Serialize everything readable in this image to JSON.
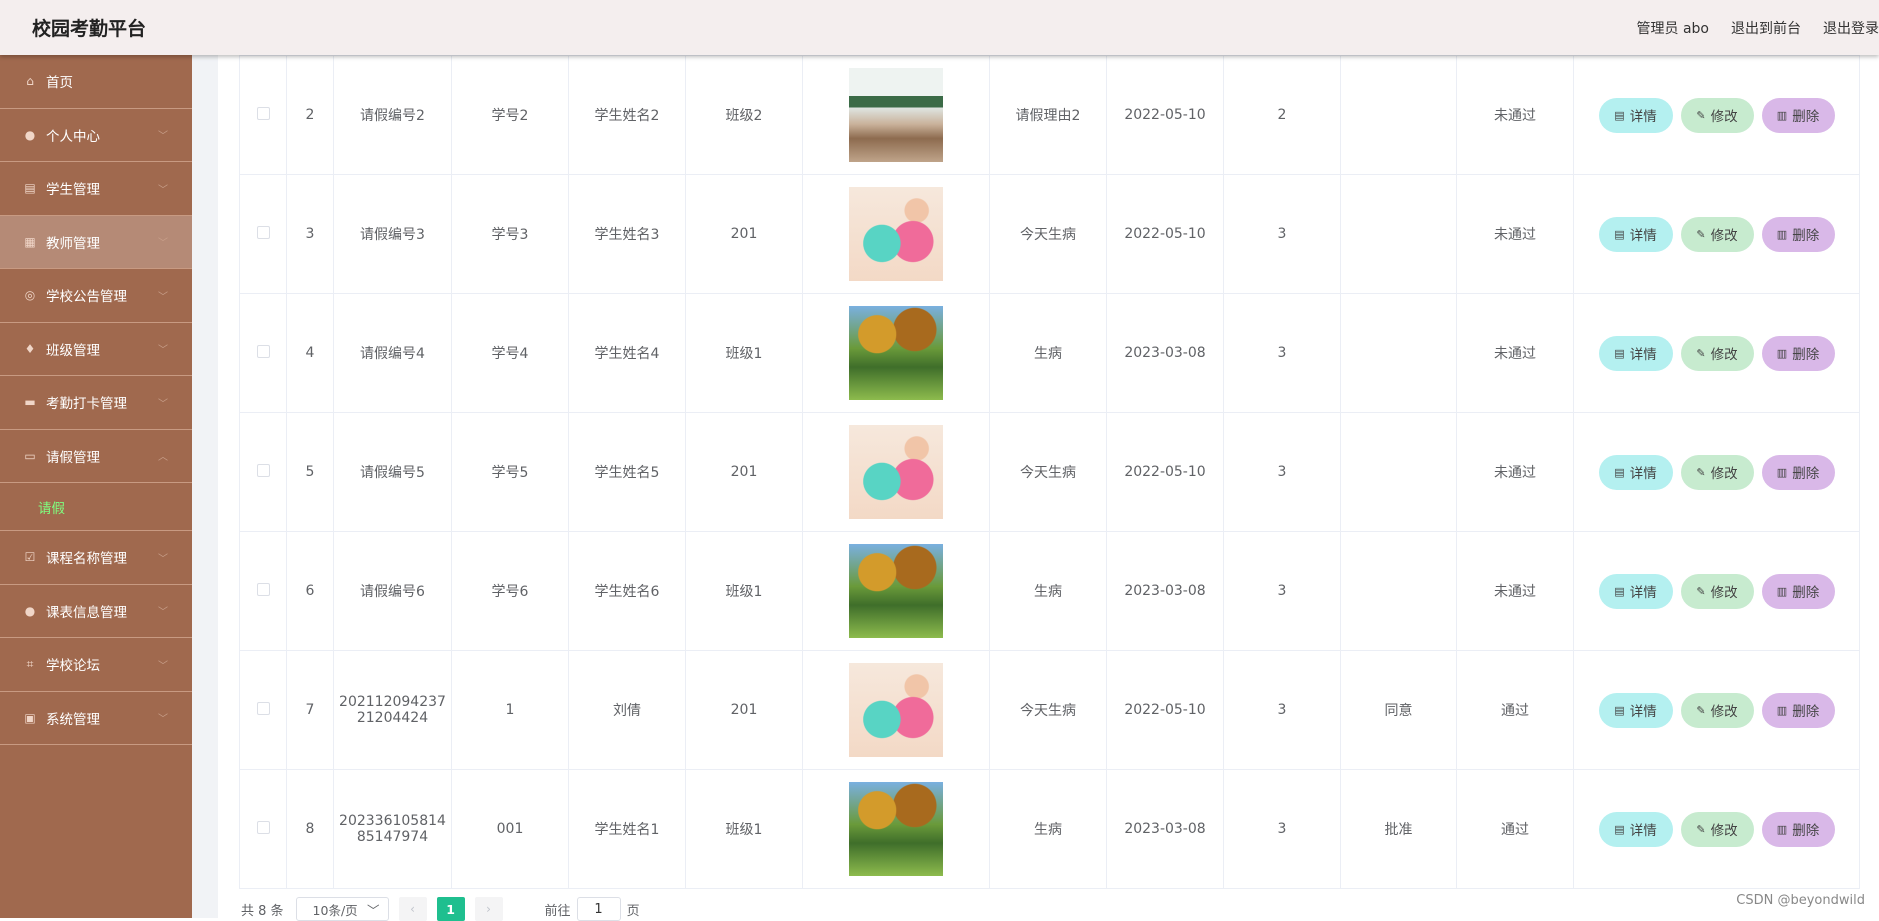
{
  "header": {
    "app_title": "校园考勤平台",
    "admin_label": "管理员 abo",
    "back_front_label": "退出到前台",
    "logout_label": "退出登录"
  },
  "sidebar": {
    "items": [
      {
        "label": "首页",
        "icon": "home-icon",
        "has_arrow": false
      },
      {
        "label": "个人中心",
        "icon": "user-icon",
        "has_arrow": true
      },
      {
        "label": "学生管理",
        "icon": "clipboard-icon",
        "has_arrow": true
      },
      {
        "label": "教师管理",
        "icon": "grid-icon",
        "has_arrow": true,
        "active": true
      },
      {
        "label": "学校公告管理",
        "icon": "compass-icon",
        "has_arrow": true
      },
      {
        "label": "班级管理",
        "icon": "location-icon",
        "has_arrow": true
      },
      {
        "label": "考勤打卡管理",
        "icon": "ticket-icon",
        "has_arrow": true
      },
      {
        "label": "请假管理",
        "icon": "chat-icon",
        "has_arrow": true,
        "expanded": true
      },
      {
        "label": "课程名称管理",
        "icon": "checkbox-icon",
        "has_arrow": true
      },
      {
        "label": "课表信息管理",
        "icon": "user-icon",
        "has_arrow": true
      },
      {
        "label": "学校论坛",
        "icon": "crop-icon",
        "has_arrow": true
      },
      {
        "label": "系统管理",
        "icon": "camera-icon",
        "has_arrow": true
      }
    ],
    "sub_item": "请假"
  },
  "table": {
    "rows": [
      {
        "idx": "2",
        "leave_no": "请假编号2",
        "student_no": "学号2",
        "student_name": "学生姓名2",
        "class_name": "班级2",
        "image": "img-classroom",
        "reason": "请假理由2",
        "date": "2022-05-10",
        "days": "2",
        "reply": "",
        "status": "未通过"
      },
      {
        "idx": "3",
        "leave_no": "请假编号3",
        "student_no": "学号3",
        "student_name": "学生姓名3",
        "class_name": "201",
        "image": "img-plush",
        "reason": "今天生病",
        "date": "2022-05-10",
        "days": "3",
        "reply": "",
        "status": "未通过"
      },
      {
        "idx": "4",
        "leave_no": "请假编号4",
        "student_no": "学号4",
        "student_name": "学生姓名4",
        "class_name": "班级1",
        "image": "img-park",
        "reason": "生病",
        "date": "2023-03-08",
        "days": "3",
        "reply": "",
        "status": "未通过"
      },
      {
        "idx": "5",
        "leave_no": "请假编号5",
        "student_no": "学号5",
        "student_name": "学生姓名5",
        "class_name": "201",
        "image": "img-plush",
        "reason": "今天生病",
        "date": "2022-05-10",
        "days": "3",
        "reply": "",
        "status": "未通过"
      },
      {
        "idx": "6",
        "leave_no": "请假编号6",
        "student_no": "学号6",
        "student_name": "学生姓名6",
        "class_name": "班级1",
        "image": "img-park",
        "reason": "生病",
        "date": "2023-03-08",
        "days": "3",
        "reply": "",
        "status": "未通过"
      },
      {
        "idx": "7",
        "leave_no_line1": "202112094237",
        "leave_no_line2": "21204424",
        "student_no": "1",
        "student_name": "刘倩",
        "class_name": "201",
        "image": "img-plush",
        "reason": "今天生病",
        "date": "2022-05-10",
        "days": "3",
        "reply": "同意",
        "status": "通过"
      },
      {
        "idx": "8",
        "leave_no_line1": "202336105814",
        "leave_no_line2": "85147974",
        "student_no": "001",
        "student_name": "学生姓名1",
        "class_name": "班级1",
        "image": "img-park",
        "reason": "生病",
        "date": "2023-03-08",
        "days": "3",
        "reply": "批准",
        "status": "通过"
      }
    ],
    "actions": {
      "detail": "详情",
      "edit": "修改",
      "delete": "删除"
    }
  },
  "pager": {
    "total": "共 8 条",
    "page_size": "10条/页",
    "current_page": "1",
    "goto_prefix": "前往",
    "goto_value": "1",
    "goto_suffix": "页"
  },
  "watermark": "CSDN @beyondwild",
  "colors": {
    "sidebar_bg": "#a0694e",
    "header_bg": "#f4eeee",
    "detail_btn": "#b4f0f0",
    "edit_btn": "#c7ebcf",
    "delete_btn": "#d9b8e8",
    "pager_active": "#1fbf8f",
    "submenu_text": "#7fff7f"
  }
}
